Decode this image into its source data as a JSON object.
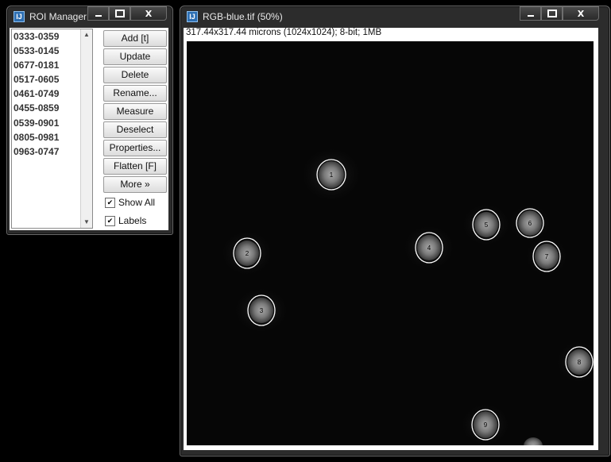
{
  "roi_manager": {
    "title": "ROI Manager",
    "items": [
      "0333-0359",
      "0533-0145",
      "0677-0181",
      "0517-0605",
      "0461-0749",
      "0455-0859",
      "0539-0901",
      "0805-0981",
      "0963-0747"
    ],
    "buttons": {
      "add": "Add [t]",
      "update": "Update",
      "delete": "Delete",
      "rename": "Rename...",
      "measure": "Measure",
      "deselect": "Deselect",
      "properties": "Properties...",
      "flatten": "Flatten [F]",
      "more": "More »"
    },
    "checkboxes": {
      "show_all": "Show All",
      "labels": "Labels",
      "show_all_checked": true,
      "labels_checked": true
    }
  },
  "image_window": {
    "title": "RGB-blue.tif (50%)",
    "info": "317.44x317.44 microns (1024x1024); 8-bit; 1MB",
    "roi_labels": [
      "1",
      "2",
      "3",
      "4",
      "5",
      "6",
      "7",
      "8",
      "9"
    ]
  },
  "window_controls": {
    "minimize": "minimize",
    "maximize": "maximize",
    "close": "X"
  },
  "colors": {
    "frame": "#2c2c2c",
    "roi_outline": "#ffffff",
    "image_bg": "#060606",
    "icon_blue": "#2d6fb3"
  }
}
